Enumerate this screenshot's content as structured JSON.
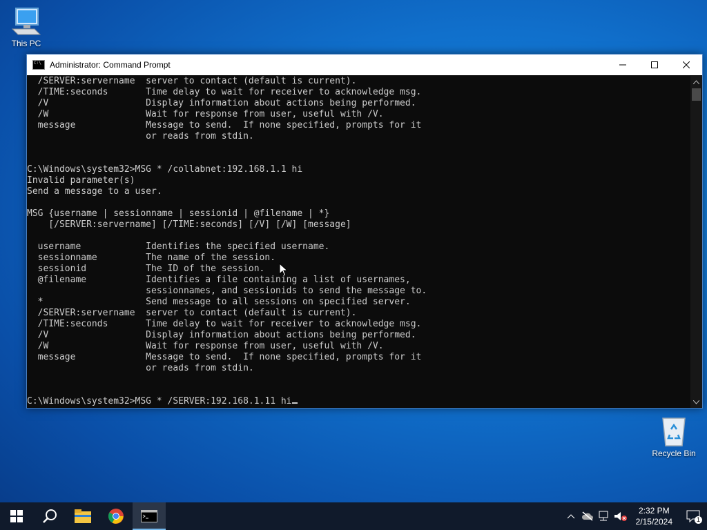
{
  "desktop": {
    "icons": [
      {
        "label": "This PC"
      },
      {
        "label": "Recycle Bin"
      }
    ]
  },
  "window": {
    "title": "Administrator: Command Prompt",
    "controls": {
      "minimize": "minimize-icon",
      "maximize": "maximize-icon",
      "close": "close-icon"
    },
    "console_lines": [
      "  /SERVER:servername  server to contact (default is current).",
      "  /TIME:seconds       Time delay to wait for receiver to acknowledge msg.",
      "  /V                  Display information about actions being performed.",
      "  /W                  Wait for response from user, useful with /V.",
      "  message             Message to send.  If none specified, prompts for it",
      "                      or reads from stdin.",
      "",
      "",
      "C:\\Windows\\system32>MSG * /collabnet:192.168.1.1 hi",
      "Invalid parameter(s)",
      "Send a message to a user.",
      "",
      "MSG {username | sessionname | sessionid | @filename | *}",
      "    [/SERVER:servername] [/TIME:seconds] [/V] [/W] [message]",
      "",
      "  username            Identifies the specified username.",
      "  sessionname         The name of the session.",
      "  sessionid           The ID of the session.",
      "  @filename           Identifies a file containing a list of usernames,",
      "                      sessionnames, and sessionids to send the message to.",
      "  *                   Send message to all sessions on specified server.",
      "  /SERVER:servername  server to contact (default is current).",
      "  /TIME:seconds       Time delay to wait for receiver to acknowledge msg.",
      "  /V                  Display information about actions being performed.",
      "  /W                  Wait for response from user, useful with /V.",
      "  message             Message to send.  If none specified, prompts for it",
      "                      or reads from stdin.",
      "",
      ""
    ],
    "input_line": "C:\\Windows\\system32>MSG * /SERVER:192.168.1.11 hi"
  },
  "taskbar": {
    "items": [
      "start-icon",
      "search-icon",
      "file-explorer-icon",
      "chrome-icon",
      "command-prompt-icon"
    ],
    "tray": {
      "time": "2:32 PM",
      "date": "2/15/2024",
      "notification_count": "1"
    }
  },
  "colors": {
    "console_bg": "#0c0c0c",
    "console_fg": "#cccccc",
    "taskbar_bg": "#101a2b",
    "accent": "#76b9ed"
  }
}
